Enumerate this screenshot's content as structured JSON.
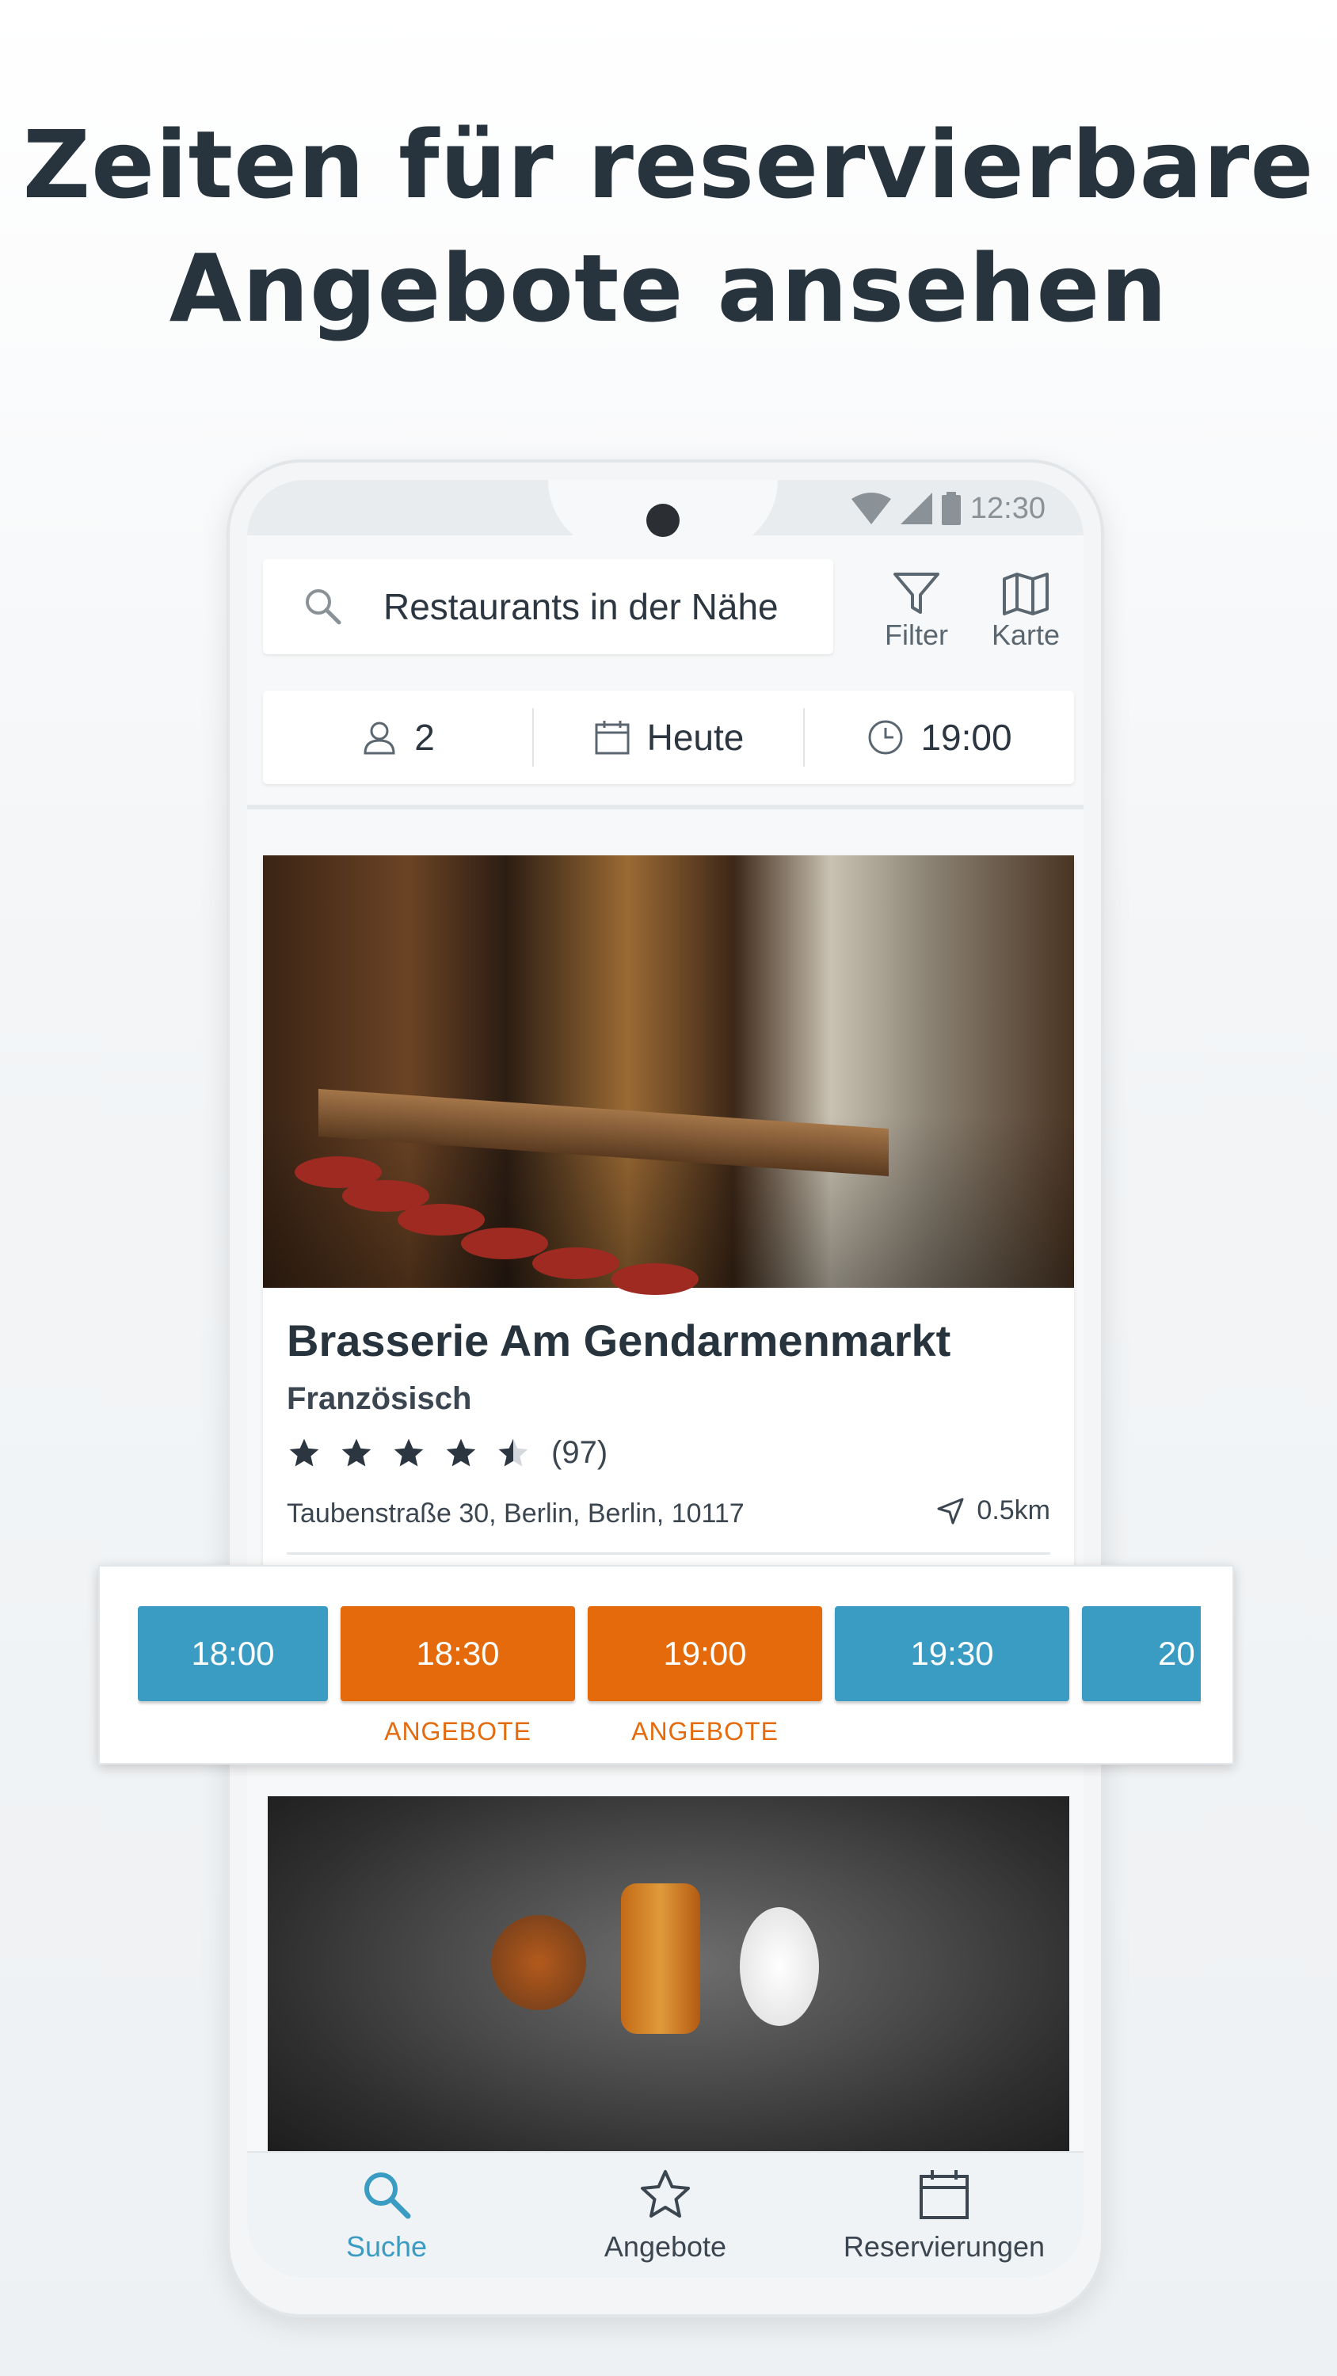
{
  "headline": {
    "line1": "Zeiten für reservierbare",
    "line2": "Angebote ansehen"
  },
  "status_bar": {
    "time": "12:30"
  },
  "search": {
    "text": "Restaurants in der Nähe"
  },
  "top_actions": {
    "filter_label": "Filter",
    "map_label": "Karte"
  },
  "params": {
    "guests": "2",
    "date": "Heute",
    "time": "19:00"
  },
  "restaurant": {
    "name": "Brasserie Am Gendarmenmarkt",
    "cuisine": "Französisch",
    "rating": 4.5,
    "review_count": "(97)",
    "address": "Taubenstraße 30, Berlin, Berlin, 10117",
    "distance": "0.5km"
  },
  "time_slots": [
    {
      "time": "18:00",
      "type": "standard",
      "color": "#3a9cc2",
      "label": ""
    },
    {
      "time": "18:30",
      "type": "offer",
      "color": "#e46a0c",
      "label": "ANGEBOTE"
    },
    {
      "time": "19:00",
      "type": "offer",
      "color": "#e46a0c",
      "label": "ANGEBOTE"
    },
    {
      "time": "19:30",
      "type": "standard",
      "color": "#3a9cc2",
      "label": ""
    },
    {
      "time": "20",
      "type": "standard",
      "color": "#3a9cc2",
      "label": ""
    }
  ],
  "bottom_nav": {
    "search_label": "Suche",
    "offers_label": "Angebote",
    "reservations_label": "Reservierungen"
  },
  "colors": {
    "accent_blue": "#3a9cc2",
    "accent_orange": "#e46a0c",
    "text_dark": "#27343e"
  }
}
